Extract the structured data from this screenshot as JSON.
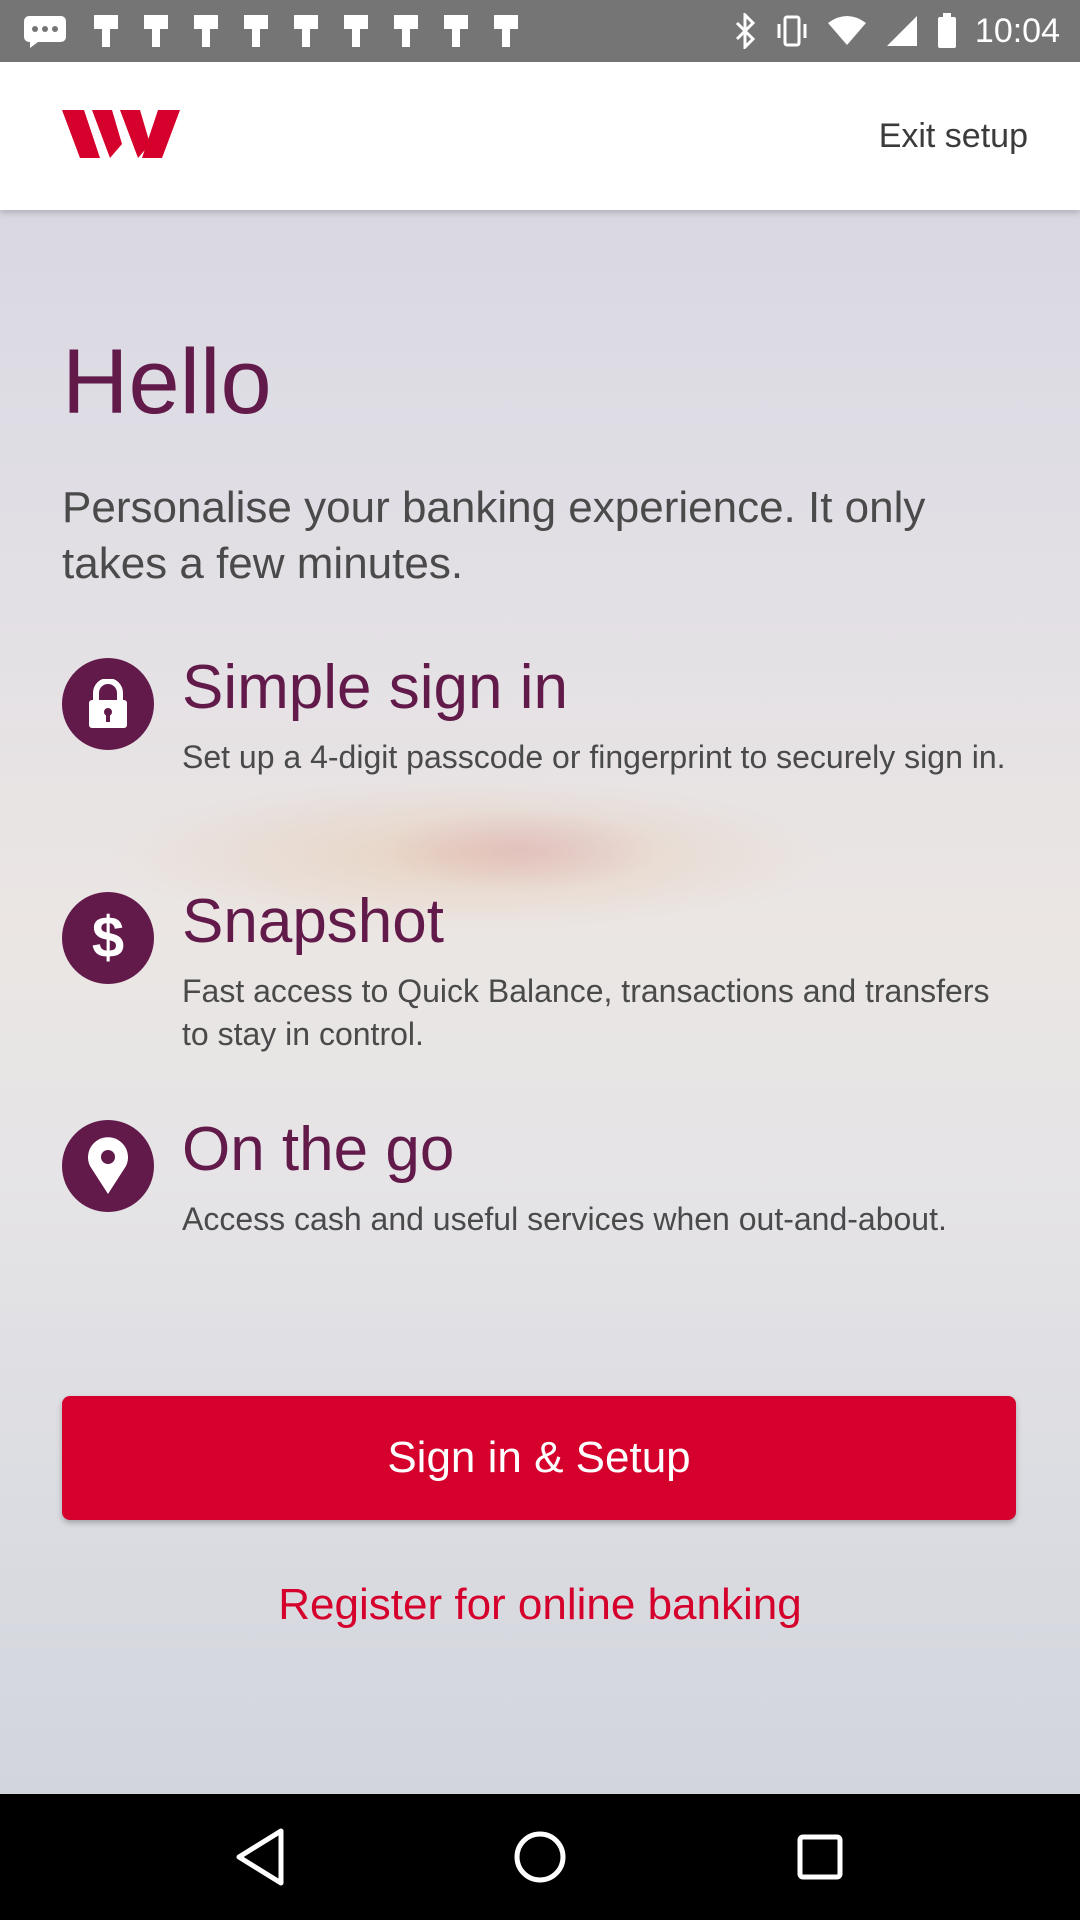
{
  "status_bar": {
    "time": "10:04",
    "icons": [
      "message-icon",
      "notification-icon",
      "notification-icon",
      "notification-icon",
      "notification-icon",
      "notification-icon",
      "notification-icon",
      "notification-icon",
      "notification-icon",
      "notification-icon",
      "bluetooth-icon",
      "vibrate-icon",
      "wifi-icon",
      "signal-icon",
      "battery-icon"
    ]
  },
  "header": {
    "logo": "westpac-logo",
    "exit_label": "Exit setup"
  },
  "main": {
    "greeting": "Hello",
    "intro": "Personalise your banking experience. It only takes a few minutes.",
    "features": [
      {
        "icon": "lock-icon",
        "title": "Simple sign in",
        "description": "Set up a 4-digit passcode or fingerprint to securely sign in."
      },
      {
        "icon": "dollar-icon",
        "title": "Snapshot",
        "description": "Fast access to Quick Balance, transactions and transfers to stay in control."
      },
      {
        "icon": "location-pin-icon",
        "title": "On the go",
        "description": "Access cash and useful services when out-and-about."
      }
    ],
    "primary_button": "Sign in & Setup",
    "secondary_link": "Register for online banking"
  },
  "nav_bar": {
    "buttons": [
      "back-icon",
      "home-icon",
      "recents-icon"
    ]
  },
  "colors": {
    "brand_red": "#d5002b",
    "brand_plum": "#621a4b",
    "status_bar": "#757575"
  }
}
